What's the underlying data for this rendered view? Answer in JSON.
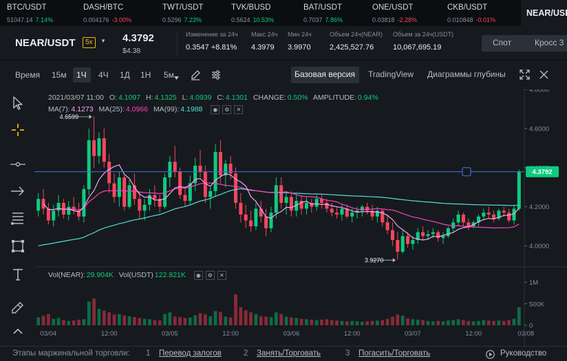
{
  "ticker": [
    {
      "name": "BTC/USDT",
      "price": "51047.14",
      "change": "7.14%",
      "dir": "up"
    },
    {
      "name": "DASH/BTC",
      "price": "0.004176",
      "change": "-3.00%",
      "dir": "dn"
    },
    {
      "name": "TWT/USDT",
      "price": "0.5296",
      "change": "7.23%",
      "dir": "up"
    },
    {
      "name": "TVK/BUSD",
      "price": "0.5624",
      "change": "10.53%",
      "dir": "up"
    },
    {
      "name": "BAT/USDT",
      "price": "0.7037",
      "change": "7.86%",
      "dir": "up"
    },
    {
      "name": "ONE/USDT",
      "price": "0.03818",
      "change": "-2.28%",
      "dir": "dn"
    },
    {
      "name": "CKB/USDT",
      "price": "0.010848",
      "change": "-0.01%",
      "dir": "dn"
    }
  ],
  "corner_pair": "NEAR/USDT",
  "header": {
    "pair": "NEAR/USDT",
    "leverage": "5x",
    "last_price": "4.3792",
    "last_usd": "$4.38",
    "stats": [
      {
        "label": "Изменение за 24ч",
        "value": "0.3547 +8.81%",
        "color": "#0ecb81"
      },
      {
        "label": "Макс 24ч",
        "value": "4.3979",
        "color": "#eaecef"
      },
      {
        "label": "Мин 24ч",
        "value": "3.9970",
        "color": "#eaecef"
      },
      {
        "label": "Объем 24ч(NEAR)",
        "value": "2,425,527.76",
        "color": "#eaecef"
      },
      {
        "label": "Объем за 24ч(USDT)",
        "value": "10,067,695.19",
        "color": "#eaecef"
      }
    ],
    "market_tabs": [
      "Спот",
      "Кросс 3"
    ]
  },
  "toolbar": {
    "time_label": "Время",
    "timeframes": [
      "15м",
      "1Ч",
      "4Ч",
      "1Д",
      "1Н",
      "5м"
    ],
    "active_timeframe": "1Ч",
    "views": [
      "Базовая версия",
      "TradingView",
      "Диаграммы глубины"
    ],
    "active_view": "Базовая версия"
  },
  "ohlc": {
    "date": "2021/03/07 11:00",
    "o_key": "O:",
    "o": "4.1097",
    "h_key": "H:",
    "h": "4.1325",
    "l_key": "L:",
    "l": "4.0939",
    "c_key": "C:",
    "c": "4.1301",
    "change_key": "CHANGE:",
    "change": "0.50%",
    "amp_key": "AMPLITUDE:",
    "amp": "0.94%"
  },
  "ma": {
    "ma7_key": "MA(7):",
    "ma7": "4.1273",
    "ma25_key": "MA(25):",
    "ma25": "4.0966",
    "ma99_key": "MA(99):",
    "ma99": "4.1988"
  },
  "volume_legend": {
    "near_key": "Vol(NEAR):",
    "near": "29.904K",
    "usdt_key": "Vol(USDT)",
    "usdt": "122.821K"
  },
  "colors": {
    "up": "#0ecb81",
    "down": "#f6465d",
    "ma7": "#f7a6f2",
    "ma25": "#ff3fbf",
    "ma99": "#4fe0d9",
    "hline": "#3d6ec9"
  },
  "chart_data": {
    "type": "candlestick",
    "price_ticks": [
      "4.8000",
      "4.6000",
      "4.4000",
      "4.2000",
      "4.0000"
    ],
    "price_tick_values": [
      4.8,
      4.6,
      4.4,
      4.2,
      4.0
    ],
    "price_range": [
      3.9,
      4.8
    ],
    "volume_ticks": [
      "1M",
      "500K",
      "0"
    ],
    "volume_tick_values": [
      1000000,
      500000,
      0
    ],
    "volume_range": [
      0,
      1200000
    ],
    "time_ticks": [
      "03/04",
      "12:00",
      "03/05",
      "12:00",
      "03/06",
      "12:00",
      "03/07",
      "12:00",
      "03/08"
    ],
    "current_price": 4.3792,
    "current_price_label": "4.3792",
    "high_marker": {
      "value": 4.6599,
      "label": "4.6599"
    },
    "low_marker": {
      "value": 3.927,
      "label": "3.9270"
    },
    "candles_count": 96,
    "candles": [
      [
        4.18,
        4.27,
        4.15,
        4.24,
        180000
      ],
      [
        4.24,
        4.29,
        4.16,
        4.19,
        220000
      ],
      [
        4.19,
        4.22,
        4.11,
        4.13,
        260000
      ],
      [
        4.13,
        4.21,
        4.1,
        4.18,
        150000
      ],
      [
        4.18,
        4.26,
        4.15,
        4.22,
        170000
      ],
      [
        4.22,
        4.24,
        4.14,
        4.16,
        120000
      ],
      [
        4.16,
        4.23,
        4.13,
        4.2,
        100000
      ],
      [
        4.2,
        4.25,
        4.16,
        4.18,
        110000
      ],
      [
        4.18,
        4.22,
        4.13,
        4.15,
        130000
      ],
      [
        4.15,
        4.31,
        4.12,
        4.29,
        140000
      ],
      [
        4.29,
        4.6,
        4.26,
        4.54,
        550000
      ],
      [
        4.54,
        4.66,
        4.4,
        4.46,
        620000
      ],
      [
        4.46,
        4.58,
        4.42,
        4.55,
        380000
      ],
      [
        4.55,
        4.6,
        4.4,
        4.43,
        340000
      ],
      [
        4.43,
        4.47,
        4.27,
        4.32,
        300000
      ],
      [
        4.32,
        4.37,
        4.22,
        4.25,
        250000
      ],
      [
        4.25,
        4.38,
        4.2,
        4.35,
        260000
      ],
      [
        4.35,
        4.36,
        4.18,
        4.2,
        230000
      ],
      [
        4.2,
        4.34,
        4.19,
        4.31,
        210000
      ],
      [
        4.31,
        4.37,
        4.21,
        4.24,
        190000
      ],
      [
        4.24,
        4.28,
        4.14,
        4.18,
        170000
      ],
      [
        4.18,
        4.24,
        4.13,
        4.21,
        150000
      ],
      [
        4.21,
        4.29,
        4.18,
        4.26,
        140000
      ],
      [
        4.26,
        4.31,
        4.2,
        4.24,
        120000
      ],
      [
        4.24,
        4.26,
        4.17,
        4.2,
        110000
      ],
      [
        4.2,
        4.37,
        4.19,
        4.35,
        260000
      ],
      [
        4.35,
        4.46,
        4.3,
        4.43,
        300000
      ],
      [
        4.43,
        4.51,
        4.35,
        4.38,
        200000
      ],
      [
        4.38,
        4.4,
        4.24,
        4.26,
        190000
      ],
      [
        4.26,
        4.3,
        4.2,
        4.23,
        170000
      ],
      [
        4.23,
        4.36,
        4.21,
        4.32,
        180000
      ],
      [
        4.32,
        4.45,
        4.28,
        4.41,
        230000
      ],
      [
        4.41,
        4.49,
        4.35,
        4.38,
        280000
      ],
      [
        4.38,
        4.41,
        4.22,
        4.25,
        250000
      ],
      [
        4.25,
        4.3,
        4.19,
        4.28,
        210000
      ],
      [
        4.28,
        4.52,
        4.25,
        4.48,
        330000
      ],
      [
        4.48,
        4.54,
        4.32,
        4.36,
        310000
      ],
      [
        4.36,
        4.44,
        4.3,
        4.42,
        200000
      ],
      [
        4.42,
        4.46,
        4.34,
        4.37,
        180000
      ],
      [
        4.37,
        4.4,
        4.19,
        4.22,
        720000
      ],
      [
        4.22,
        4.27,
        4.12,
        4.16,
        420000
      ],
      [
        4.16,
        4.21,
        4.09,
        4.13,
        350000
      ],
      [
        4.13,
        4.18,
        4.07,
        4.1,
        300000
      ],
      [
        4.1,
        4.22,
        4.08,
        4.19,
        260000
      ],
      [
        4.19,
        4.23,
        4.12,
        4.15,
        210000
      ],
      [
        4.15,
        4.19,
        4.05,
        4.09,
        200000
      ],
      [
        4.09,
        4.2,
        4.07,
        4.17,
        190000
      ],
      [
        4.17,
        4.35,
        4.14,
        4.31,
        300000
      ],
      [
        4.31,
        4.35,
        4.19,
        4.22,
        260000
      ],
      [
        4.22,
        4.28,
        4.16,
        4.25,
        200000
      ],
      [
        4.25,
        4.28,
        4.15,
        4.18,
        180000
      ],
      [
        4.18,
        4.26,
        4.15,
        4.23,
        170000
      ],
      [
        4.23,
        4.26,
        4.16,
        4.19,
        150000
      ],
      [
        4.19,
        4.25,
        4.16,
        4.22,
        140000
      ],
      [
        4.22,
        4.24,
        4.17,
        4.2,
        130000
      ],
      [
        4.2,
        4.26,
        4.18,
        4.24,
        120000
      ],
      [
        4.24,
        4.26,
        4.19,
        4.22,
        130000
      ],
      [
        4.22,
        4.24,
        4.17,
        4.19,
        140000
      ],
      [
        4.19,
        4.22,
        4.15,
        4.17,
        120000
      ],
      [
        4.17,
        4.2,
        4.14,
        4.16,
        110000
      ],
      [
        4.16,
        4.21,
        4.13,
        4.19,
        100000
      ],
      [
        4.19,
        4.21,
        4.14,
        4.15,
        90000
      ],
      [
        4.15,
        4.19,
        4.12,
        4.17,
        100000
      ],
      [
        4.17,
        4.2,
        4.14,
        4.18,
        90000
      ],
      [
        4.18,
        4.21,
        4.15,
        4.2,
        80000
      ],
      [
        4.2,
        4.22,
        4.16,
        4.18,
        90000
      ],
      [
        4.18,
        4.21,
        4.13,
        4.15,
        100000
      ],
      [
        4.15,
        4.2,
        4.12,
        4.18,
        110000
      ],
      [
        4.18,
        4.19,
        4.1,
        4.12,
        120000
      ],
      [
        4.12,
        4.16,
        4.06,
        4.08,
        150000
      ],
      [
        4.08,
        4.12,
        4.0,
        4.03,
        200000
      ],
      [
        4.03,
        4.07,
        3.93,
        3.97,
        250000
      ],
      [
        3.97,
        4.08,
        3.96,
        4.05,
        220000
      ],
      [
        4.05,
        4.07,
        3.99,
        4.01,
        160000
      ],
      [
        4.01,
        4.05,
        3.98,
        4.03,
        140000
      ],
      [
        4.03,
        4.09,
        4.01,
        4.07,
        130000
      ],
      [
        4.07,
        4.1,
        4.03,
        4.05,
        120000
      ],
      [
        4.05,
        4.08,
        4.03,
        4.06,
        100000
      ],
      [
        4.06,
        4.09,
        4.04,
        4.07,
        90000
      ],
      [
        4.07,
        4.08,
        4.02,
        4.04,
        100000
      ],
      [
        4.04,
        4.07,
        4.01,
        4.05,
        90000
      ],
      [
        4.05,
        4.1,
        4.04,
        4.09,
        110000
      ],
      [
        4.09,
        4.14,
        4.07,
        4.12,
        120000
      ],
      [
        4.12,
        4.18,
        4.1,
        4.16,
        140000
      ],
      [
        4.16,
        4.17,
        4.1,
        4.12,
        120000
      ],
      [
        4.12,
        4.14,
        4.08,
        4.1,
        100000
      ],
      [
        4.1,
        4.13,
        4.09,
        4.12,
        90000
      ],
      [
        4.12,
        4.16,
        4.1,
        4.15,
        100000
      ],
      [
        4.15,
        4.19,
        4.13,
        4.17,
        120000
      ],
      [
        4.17,
        4.2,
        4.14,
        4.16,
        110000
      ],
      [
        4.16,
        4.18,
        4.12,
        4.14,
        100000
      ],
      [
        4.14,
        4.19,
        4.13,
        4.18,
        110000
      ],
      [
        4.18,
        4.2,
        4.15,
        4.17,
        100000
      ],
      [
        4.17,
        4.19,
        4.12,
        4.13,
        120000
      ],
      [
        4.13,
        4.21,
        4.11,
        4.19,
        150000
      ],
      [
        4.19,
        4.39,
        4.18,
        4.38,
        420000
      ]
    ]
  },
  "footer": {
    "title": "Этапы маржинальной торговли:",
    "steps": [
      {
        "n": "1",
        "label": "Перевод залогов"
      },
      {
        "n": "2",
        "label": "Занять/Торговать"
      },
      {
        "n": "3",
        "label": "Погасить/Торговать"
      }
    ],
    "guide": "Руководство"
  }
}
